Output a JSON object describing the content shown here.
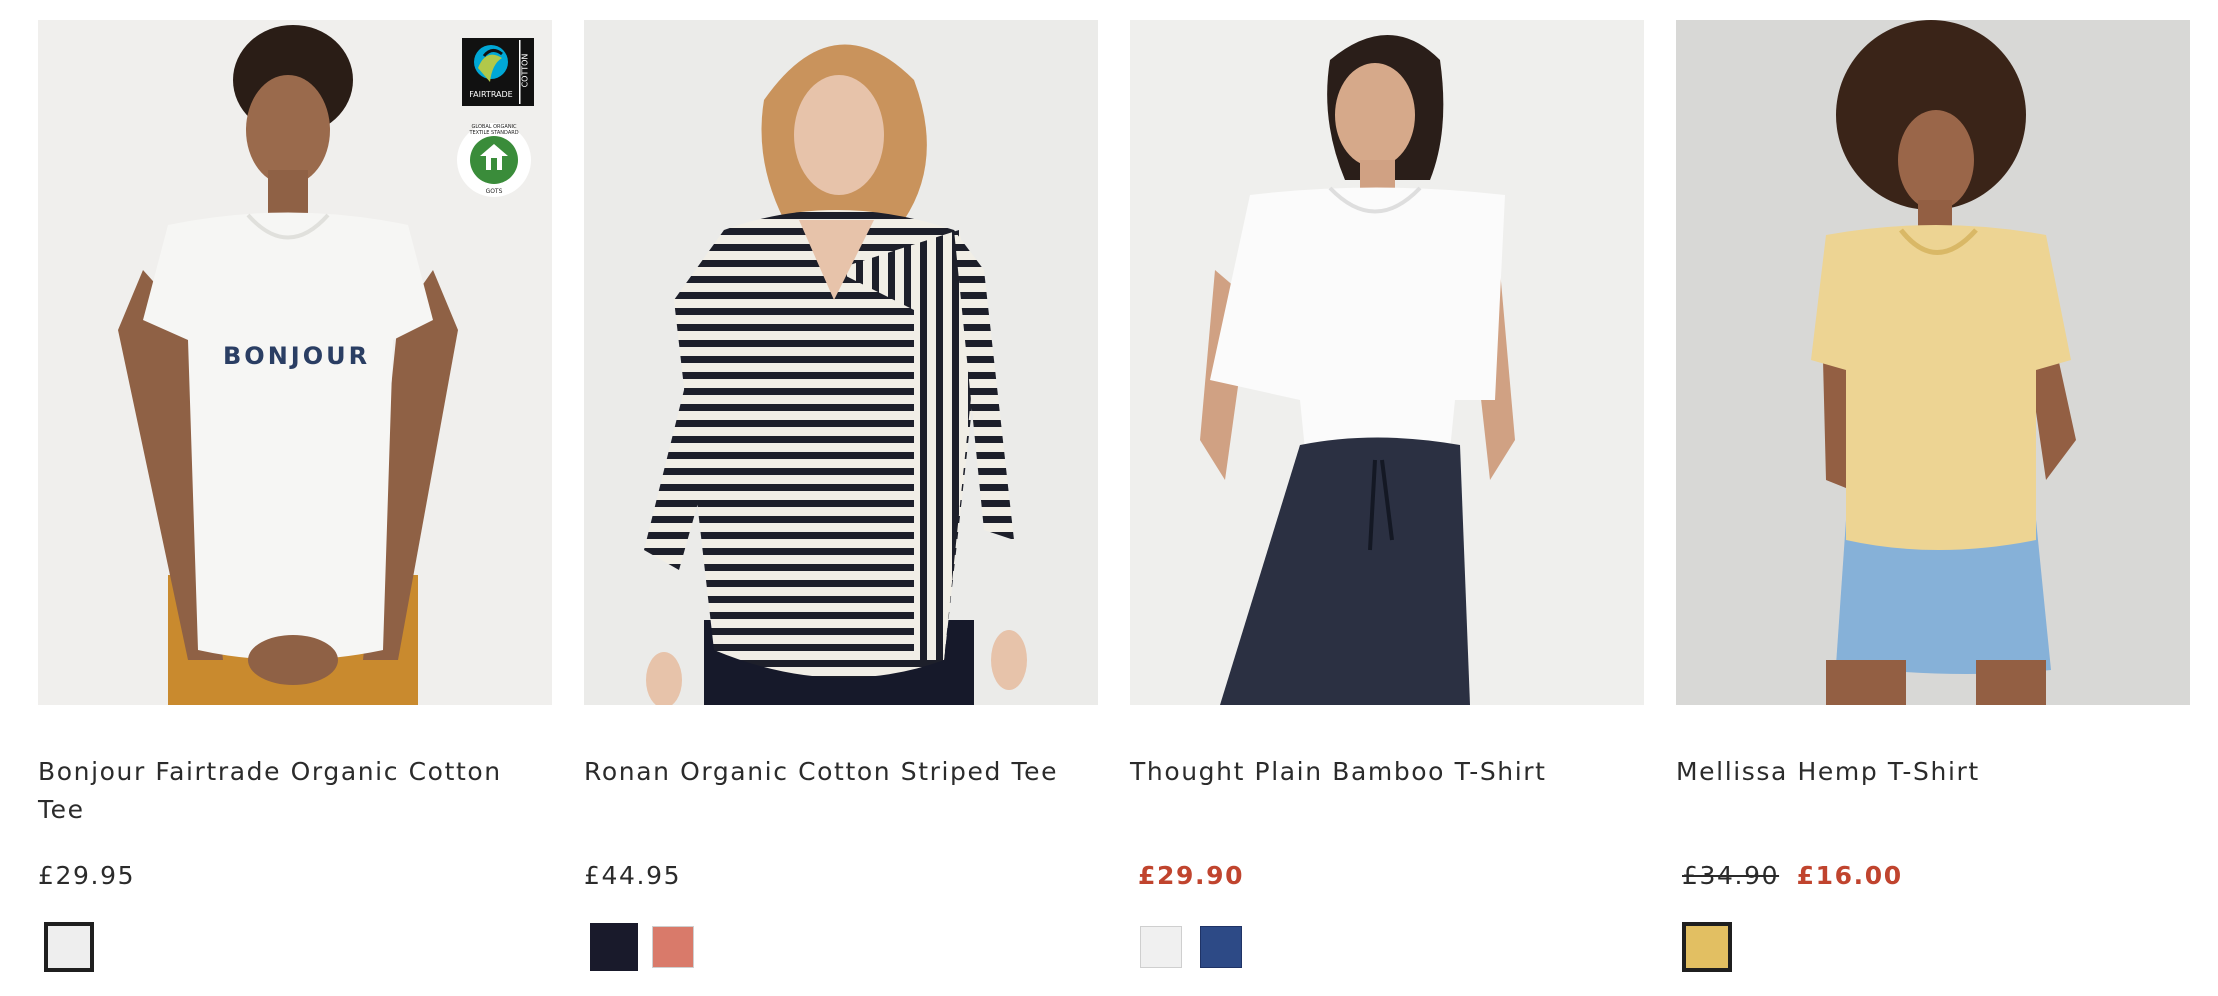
{
  "products": [
    {
      "title": "Bonjour Fairtrade Organic Cotton Tee",
      "price": "£29.95",
      "shirt_text": "BONJOUR",
      "badges": {
        "fairtrade_label": "FAIRTRADE",
        "fairtrade_side": "COTTON",
        "gots_label": "GLOBAL ORGANIC TEXTILE STANDARD",
        "gots_bottom": "GOTS"
      },
      "swatches": [
        {
          "color": "#eeeeee",
          "selected": true
        }
      ]
    },
    {
      "title": "Ronan Organic Cotton Striped Tee",
      "price": "£44.95",
      "swatches": [
        {
          "color": "#191a2b",
          "selected": false
        },
        {
          "color": "#d97a6a",
          "selected": false
        }
      ]
    },
    {
      "title": "Thought Plain Bamboo T-Shirt",
      "sale_price": "£29.90",
      "swatches": [
        {
          "color": "#f0f0f0",
          "selected": false
        },
        {
          "color": "#2d4a86",
          "selected": false
        }
      ]
    },
    {
      "title": "Mellissa Hemp T-Shirt",
      "was_price": "£34.90",
      "sale_price": "£16.00",
      "swatches": [
        {
          "color": "#e2bf62",
          "selected": true
        }
      ]
    }
  ],
  "colors": {
    "sale": "#c0442e",
    "text": "#2b2b2b",
    "selected_border": "#1f1f1f"
  },
  "icons": {
    "fairtrade": "fairtrade-cotton-badge-icon",
    "gots": "gots-organic-badge-icon"
  }
}
